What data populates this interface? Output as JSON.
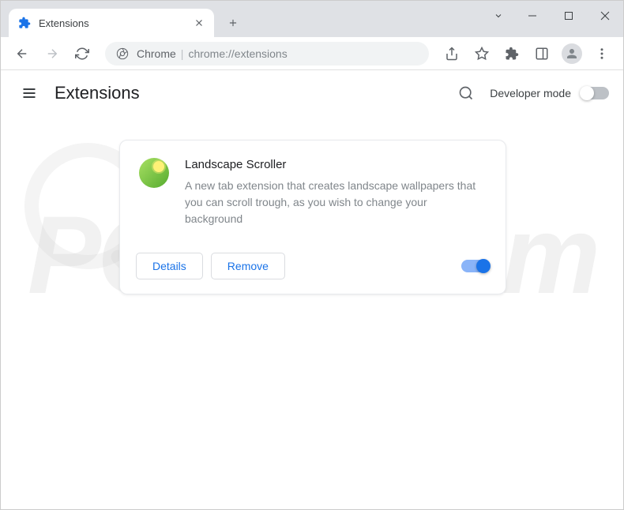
{
  "tab": {
    "title": "Extensions"
  },
  "omnibox": {
    "prefix": "Chrome",
    "url": "chrome://extensions"
  },
  "header": {
    "page_title": "Extensions",
    "dev_mode_label": "Developer mode",
    "dev_mode_on": false
  },
  "extension": {
    "name": "Landscape Scroller",
    "description": "A new tab extension that creates landscape wallpapers that you can scroll trough, as you wish to change your background",
    "details_label": "Details",
    "remove_label": "Remove",
    "enabled": true
  },
  "watermark": "PCrisk.com"
}
